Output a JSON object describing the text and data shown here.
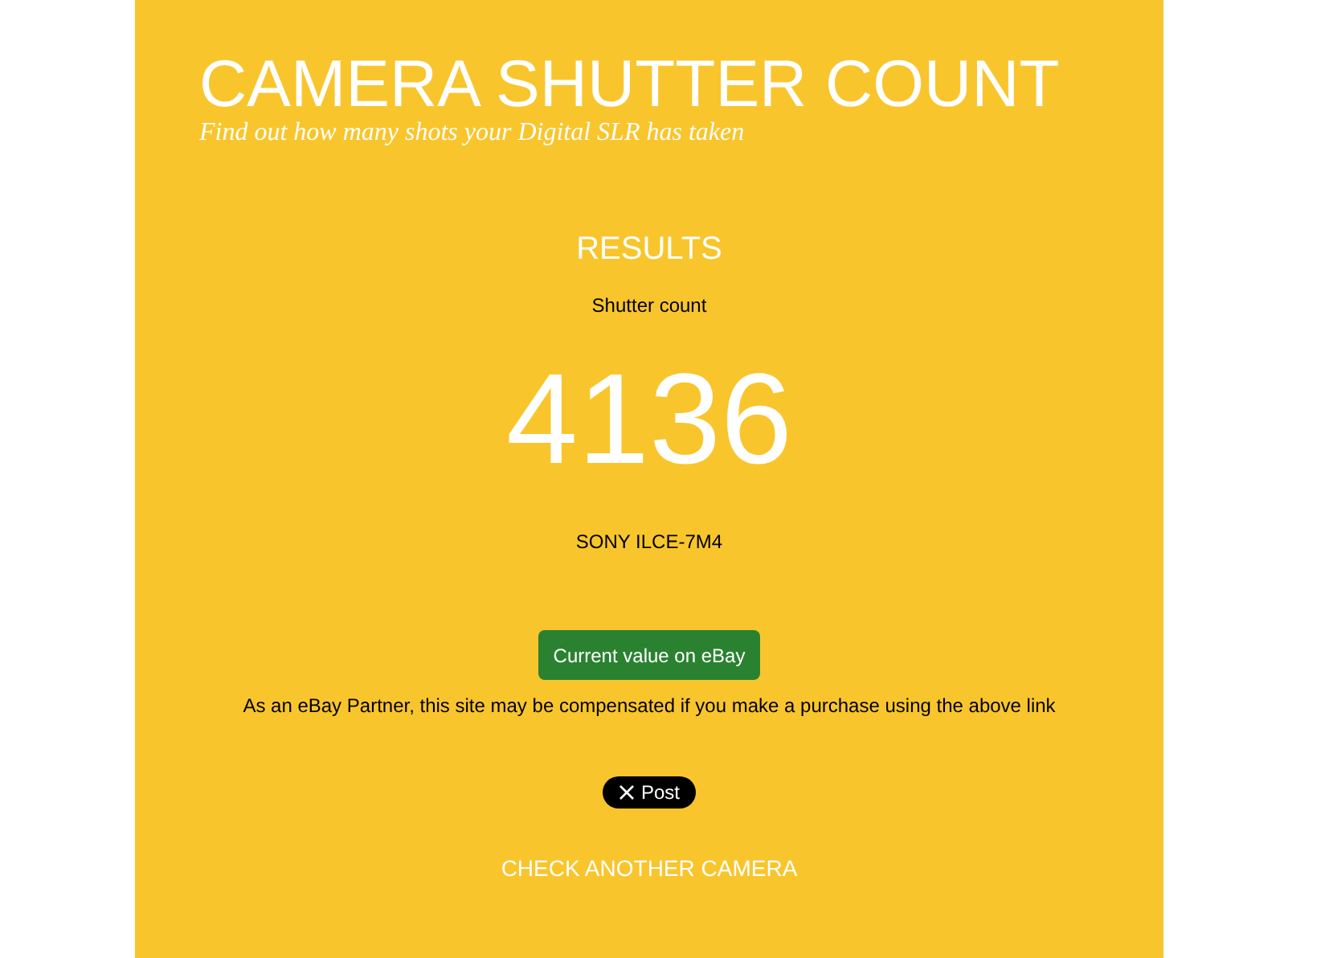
{
  "header": {
    "title": "CAMERA SHUTTER COUNT",
    "subtitle": "Find out how many shots your Digital SLR has taken"
  },
  "results": {
    "heading": "RESULTS",
    "label": "Shutter count",
    "count": "4136",
    "camera": "SONY ILCE-7M4"
  },
  "ebay_button": "Current value on eBay",
  "disclaimer": "As an eBay Partner, this site may be compensated if you make a purchase using the above link",
  "post_button": "Post",
  "check_another_link": "CHECK ANOTHER CAMERA"
}
